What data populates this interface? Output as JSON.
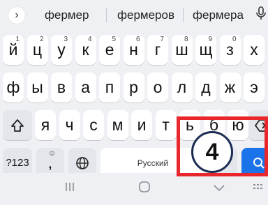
{
  "suggestions": {
    "expand_icon": "chevron-right-icon",
    "words": [
      "фермер",
      "фермеров",
      "фермера"
    ],
    "mic_icon": "microphone-icon"
  },
  "keyboard": {
    "row1": [
      {
        "label": "й",
        "hint": "1"
      },
      {
        "label": "ц",
        "hint": "2"
      },
      {
        "label": "у",
        "hint": "3"
      },
      {
        "label": "к",
        "hint": "4"
      },
      {
        "label": "е",
        "hint": "5"
      },
      {
        "label": "н",
        "hint": "6"
      },
      {
        "label": "г",
        "hint": "7"
      },
      {
        "label": "ш",
        "hint": "8"
      },
      {
        "label": "щ",
        "hint": "9"
      },
      {
        "label": "з",
        "hint": "0"
      },
      {
        "label": "х",
        "hint": ""
      }
    ],
    "row2": [
      "ф",
      "ы",
      "в",
      "а",
      "п",
      "р",
      "о",
      "л",
      "д",
      "ж",
      "э"
    ],
    "row3": [
      "я",
      "ч",
      "с",
      "м",
      "и",
      "т",
      "ь",
      "б",
      "ю"
    ],
    "shift_icon": "shift-icon",
    "backspace_icon": "backspace-icon",
    "symbols_label": "?123",
    "emoji_hint": "☺",
    "comma_label": ",",
    "globe_icon": "globe-icon",
    "space_label": "Русский",
    "search_icon": "search-icon"
  },
  "overlay": {
    "step_number": "4",
    "highlight_color": "#e8262c"
  },
  "nav": {
    "recents_icon": "recents-icon",
    "home_icon": "home-icon",
    "back_icon": "back-icon",
    "keyboard_icon": "keyboard-hide-icon"
  }
}
